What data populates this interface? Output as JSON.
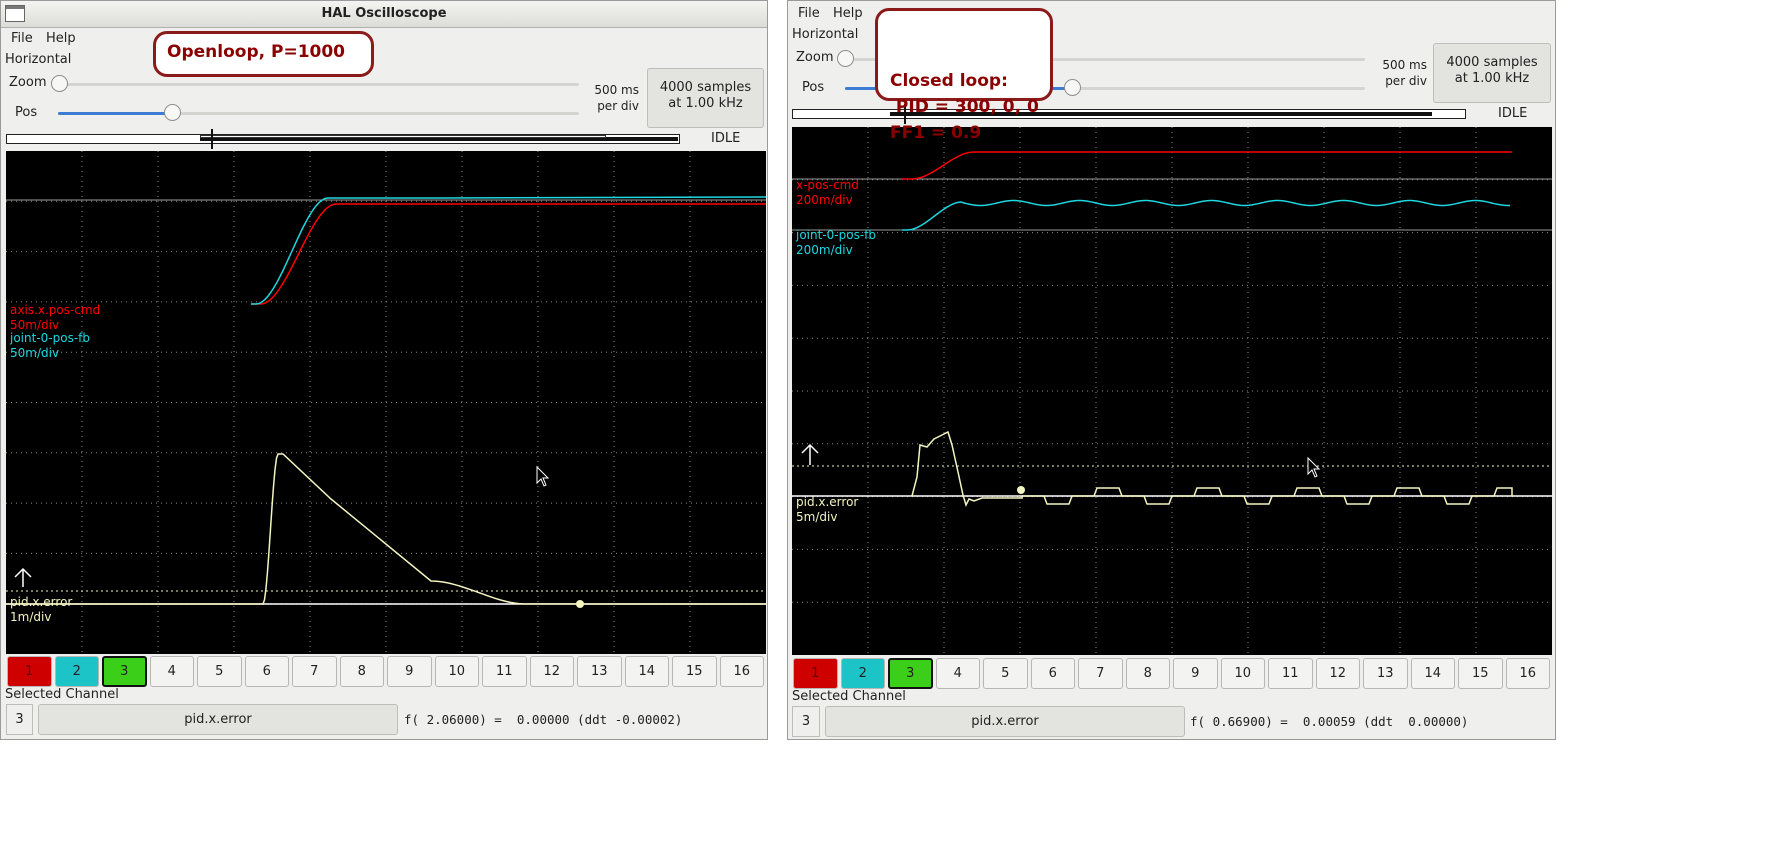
{
  "left": {
    "title": "HAL Oscilloscope",
    "menu": [
      "File",
      "Help"
    ],
    "horizontal": "Horizontal",
    "zoom_label": "Zoom",
    "pos_label": "Pos",
    "zoom_level": 0.0,
    "pos_level": 0.22,
    "rate": [
      "500 ms",
      "per div"
    ],
    "samples": [
      "4000 samples",
      "at 1.00 kHz"
    ],
    "state": "IDLE",
    "traces": [
      {
        "name": "axis.x.pos-cmd",
        "scale": "50m/div",
        "color": "#ff0000"
      },
      {
        "name": "joint-0-pos-fb",
        "scale": "50m/div",
        "color": "#1ed7e0"
      },
      {
        "name": "pid.x.error",
        "scale": "1m/div",
        "color": "#f4f4c0"
      }
    ],
    "channels": [
      "1",
      "2",
      "3",
      "4",
      "5",
      "6",
      "7",
      "8",
      "9",
      "10",
      "11",
      "12",
      "13",
      "14",
      "15",
      "16"
    ],
    "selected_channel_label": "Selected Channel",
    "selected_number": "3",
    "selected_name": "pid.x.error",
    "readout": "f( 2.06000) =  0.00000 (ddt -0.00002)",
    "annotation": [
      "Openloop, P=1000"
    ]
  },
  "right": {
    "menu": [
      "File",
      "Help"
    ],
    "horizontal": "Horizontal",
    "zoom_label": "Zoom",
    "pos_label": "Pos",
    "zoom_level": 0.0,
    "pos_level": 0.44,
    "rate": [
      "500 ms",
      "per div"
    ],
    "samples": [
      "4000 samples",
      "at 1.00 kHz"
    ],
    "state": "IDLE",
    "traces": [
      {
        "name": "x-pos-cmd",
        "scale": "200m/div",
        "color": "#ff0000"
      },
      {
        "name": "joint-0-pos-fb",
        "scale": "200m/div",
        "color": "#1ed7e0"
      },
      {
        "name": "pid.x.error",
        "scale": "5m/div",
        "color": "#f4f4c0"
      }
    ],
    "channels": [
      "1",
      "2",
      "3",
      "4",
      "5",
      "6",
      "7",
      "8",
      "9",
      "10",
      "11",
      "12",
      "13",
      "14",
      "15",
      "16"
    ],
    "selected_channel_label": "Selected Channel",
    "selected_number": "3",
    "selected_name": "pid.x.error",
    "readout": "f( 0.66900) =  0.00059 (ddt  0.00000)",
    "annotation": [
      "Closed loop:",
      " PID = 300, 0, 0",
      "FF1 = 0.9"
    ]
  },
  "colors": {
    "annotation_border": "#8b1a1a",
    "annotation_text": "#8b0000",
    "trace_red": "#ff0000",
    "trace_cyan": "#1ed7e0",
    "trace_yellow": "#f4f4c0"
  }
}
